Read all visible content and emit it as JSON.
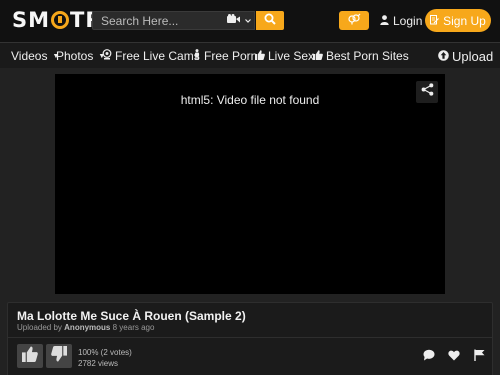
{
  "header": {
    "logo_left": "SM",
    "logo_right": "TR",
    "search_placeholder": "Search Here...",
    "login_label": "Login",
    "signup_label": "Sign Up"
  },
  "nav": {
    "videos": "Videos",
    "photos": "Photos",
    "live_cams": "Free Live Cams",
    "free_porn": "Free Porn",
    "live_sex": "Live Sex",
    "best_sites": "Best Porn Sites",
    "upload": "Upload"
  },
  "player": {
    "message": "html5: Video file not found"
  },
  "video": {
    "title": "Ma Lolotte Me Suce À Rouen (Sample 2)",
    "uploaded_prefix": "Uploaded by",
    "uploader": "Anonymous",
    "age": "8 years ago",
    "rating": "100% (2 votes)",
    "views": "2782 views"
  },
  "colors": {
    "accent": "#f7a81b",
    "header_bg": "#111111",
    "page_bg": "#222222"
  },
  "icons": [
    "video-camera-icon",
    "search-icon",
    "gender-icon",
    "user-icon",
    "signup-icon",
    "webcam-icon",
    "man-icon",
    "thumbs-up-icon",
    "upload-icon",
    "share-icon",
    "thumbs-down-icon",
    "comment-icon",
    "heart-icon",
    "flag-icon"
  ]
}
